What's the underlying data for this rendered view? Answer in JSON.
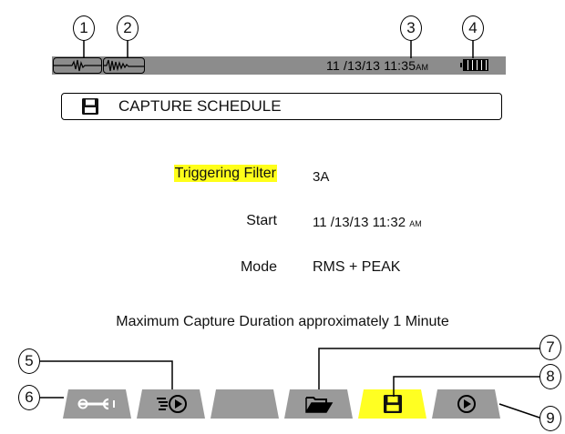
{
  "callouts": [
    "1",
    "2",
    "3",
    "4",
    "5",
    "6",
    "7",
    "8",
    "9"
  ],
  "status_bar": {
    "date": "11 /13/13",
    "time": "11:35",
    "ampm": "AM",
    "icons": [
      "waveform-trigger-icon",
      "waveform-capture-icon",
      "battery-icon"
    ]
  },
  "title": {
    "icon": "floppy-disk-icon",
    "text": "CAPTURE SCHEDULE"
  },
  "fields": [
    {
      "label": "Triggering Filter",
      "value": "3A"
    },
    {
      "label": "Start",
      "value": "11 /13/13  11:32",
      "ampm": "AM"
    },
    {
      "label": "Mode",
      "value": "RMS + PEAK"
    }
  ],
  "footnote": "Maximum Capture Duration approximately 1 Minute",
  "tabs": [
    {
      "name": "wrench",
      "icon": "wrench-icon",
      "active": false
    },
    {
      "name": "record-play",
      "icon": "record-play-icon",
      "active": false
    },
    {
      "name": "empty",
      "icon": "",
      "active": false
    },
    {
      "name": "open-folder",
      "icon": "open-folder-icon",
      "active": false
    },
    {
      "name": "save",
      "icon": "floppy-disk-icon",
      "active": true
    },
    {
      "name": "play",
      "icon": "play-icon",
      "active": false
    }
  ],
  "colors": {
    "status_bar": "#8c8c8c",
    "tab": "#9a9a9a",
    "active_tab": "#ffff22",
    "highlight": "#ffff1a"
  }
}
